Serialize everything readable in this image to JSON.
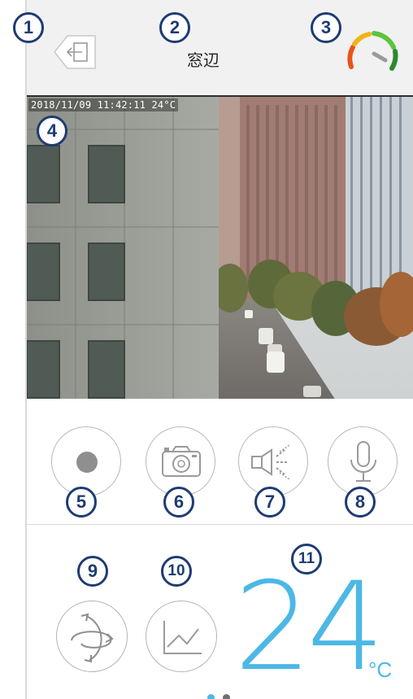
{
  "header": {
    "title": "窓辺"
  },
  "video": {
    "timestamp": "2018/11/09 11:42:11 24°C"
  },
  "controls": [
    {
      "name": "record",
      "icon": "record-icon"
    },
    {
      "name": "snapshot",
      "icon": "camera-icon"
    },
    {
      "name": "speaker",
      "icon": "speaker-icon"
    },
    {
      "name": "microphone",
      "icon": "microphone-icon"
    }
  ],
  "bottom": {
    "temperature_value": "24",
    "temperature_unit": "°C",
    "pages": 2,
    "active_page": 1
  },
  "callouts": [
    "1",
    "2",
    "3",
    "4",
    "5",
    "6",
    "7",
    "8",
    "9",
    "10",
    "11"
  ],
  "colors": {
    "accent_blue": "#4cb8e6",
    "callout_navy": "#1e3b73",
    "header_bg": "#f1f1f1"
  }
}
